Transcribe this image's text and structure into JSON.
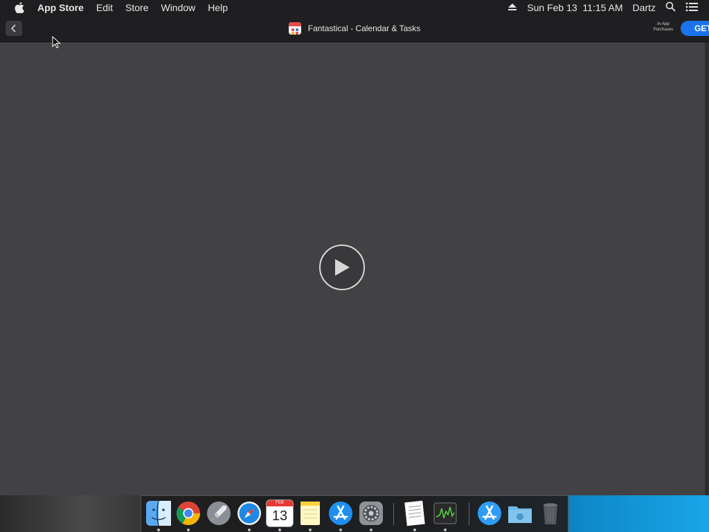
{
  "menubar": {
    "app_name": "App Store",
    "menus": [
      "Edit",
      "Store",
      "Window",
      "Help"
    ],
    "clock": "Sun Feb 13  11:15 AM",
    "user": "Dartz"
  },
  "toolbar": {
    "title": "Fantastical - Calendar & Tasks",
    "iap_line1": "In-App",
    "iap_line2": "Purchases",
    "get_label": "GET"
  },
  "dock": {
    "items": [
      {
        "name": "finder-icon",
        "running": true
      },
      {
        "name": "chrome-icon",
        "running": true
      },
      {
        "name": "launchpad-icon",
        "running": false
      },
      {
        "name": "safari-icon",
        "running": true
      },
      {
        "name": "calendar-icon",
        "running": true
      },
      {
        "name": "notes-icon",
        "running": true
      },
      {
        "name": "app-store-icon",
        "running": true
      },
      {
        "name": "system-preferences-icon",
        "running": true
      },
      {
        "name": "textedit-icon",
        "running": true
      },
      {
        "name": "activity-monitor-icon",
        "running": true
      },
      {
        "name": "app-store-download-icon",
        "running": false
      },
      {
        "name": "downloads-folder-icon",
        "running": false
      },
      {
        "name": "trash-icon",
        "running": false
      }
    ],
    "calendar_month": "FEB",
    "calendar_day": "13"
  }
}
